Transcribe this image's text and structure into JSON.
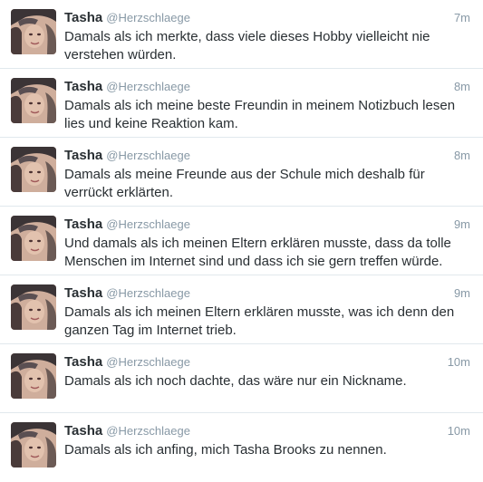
{
  "colors": {
    "name": "#292f33",
    "muted": "#8899a6",
    "divider": "#e1e8ed"
  },
  "tweets": [
    {
      "name": "Tasha",
      "handle": "@Herzschlaege",
      "time": "7m",
      "text": "Damals als ich merkte, dass viele dieses Hobby vielleicht nie verstehen würden."
    },
    {
      "name": "Tasha",
      "handle": "@Herzschlaege",
      "time": "8m",
      "text": "Damals als ich meine beste Freundin in meinem Notizbuch lesen lies und keine Reaktion kam."
    },
    {
      "name": "Tasha",
      "handle": "@Herzschlaege",
      "time": "8m",
      "text": "Damals als meine Freunde aus der Schule mich deshalb für verrückt erklärten."
    },
    {
      "name": "Tasha",
      "handle": "@Herzschlaege",
      "time": "9m",
      "text": "Und damals als ich meinen Eltern erklären musste, dass da tolle Menschen im Internet sind und dass ich sie gern treffen würde."
    },
    {
      "name": "Tasha",
      "handle": "@Herzschlaege",
      "time": "9m",
      "text": "Damals als ich meinen Eltern erklären musste, was ich denn den ganzen Tag im Internet trieb."
    },
    {
      "name": "Tasha",
      "handle": "@Herzschlaege",
      "time": "10m",
      "text": "Damals als ich noch dachte, das wäre nur ein Nickname."
    },
    {
      "name": "Tasha",
      "handle": "@Herzschlaege",
      "time": "10m",
      "text": "Damals als ich anfing, mich Tasha Brooks zu nennen."
    }
  ]
}
